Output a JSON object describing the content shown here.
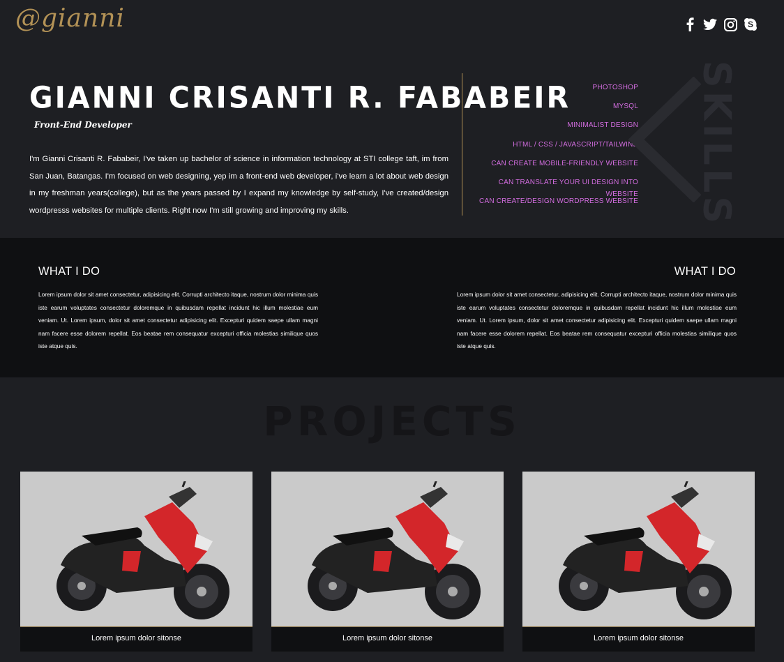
{
  "header": {
    "logo": "@gianni",
    "social_icons": [
      "facebook-icon",
      "twitter-icon",
      "instagram-icon",
      "skype-icon"
    ]
  },
  "hero": {
    "name": "GIANNI CRISANTI R. FABABEIR",
    "role": "Front-End Developer",
    "bio": "I'm Gianni Crisanti R. Fababeir, I've taken up bachelor of science in information technology at STI college taft, im from San Juan, Batangas. I'm focused on web designing, yep im a front-end web developer, i've learn a lot about web design in my freshman years(college), but as the years passed by I expand my knowledge by self-study, I've created/design wordpresss websites for multiple clients. Right now I'm still growing and improving my skills."
  },
  "skills": {
    "heading": "SKILLS",
    "items": [
      "PHOTOSHOP",
      "MYSQL",
      "MINIMALIST DESIGN",
      "HTML / CSS / JAVASCRIPT/TAILWIND",
      "CAN CREATE MOBILE-FRIENDLY WEBSITE",
      "CAN TRANSLATE YOUR UI DESIGN INTO WEBSITE",
      "CAN CREATE/DESIGN WORDPRESS WEBSITE"
    ]
  },
  "services": {
    "left": {
      "title": "WHAT I DO",
      "text": "Lorem ipsum dolor sit amet consectetur, adipisicing elit. Corrupti architecto itaque, nostrum dolor minima quis iste earum voluptates consectetur doloremque in quibusdam repellat incidunt hic illum molestiae eum veniam. Ut. Lorem ipsum, dolor sit amet consectetur adipisicing elit. Excepturi quidem saepe ullam magni nam facere esse dolorem repellat. Eos beatae rem consequatur excepturi officia molestias similique quos iste atque quis."
    },
    "right": {
      "title": "WHAT I DO",
      "text": "Lorem ipsum dolor sit amet consectetur, adipisicing elit. Corrupti architecto itaque, nostrum dolor minima quis iste earum voluptates consectetur doloremque in quibusdam repellat incidunt hic illum molestiae eum veniam. Ut. Lorem ipsum, dolor sit amet consectetur adipisicing elit. Excepturi quidem saepe ullam magni nam facere esse dolorem repellat. Eos beatae rem consequatur excepturi officia molestias similique quos iste atque quis."
    }
  },
  "projects": {
    "title": "PROJECTS",
    "cards": [
      {
        "caption": "Lorem ipsum dolor sitonse"
      },
      {
        "caption": "Lorem ipsum dolor sitonse"
      },
      {
        "caption": "Lorem ipsum dolor sitonse"
      }
    ]
  },
  "colors": {
    "background": "#1e1f23",
    "services_bg": "#0f1012",
    "gold_accent": "#b39256",
    "skill_text": "#d36de0"
  }
}
